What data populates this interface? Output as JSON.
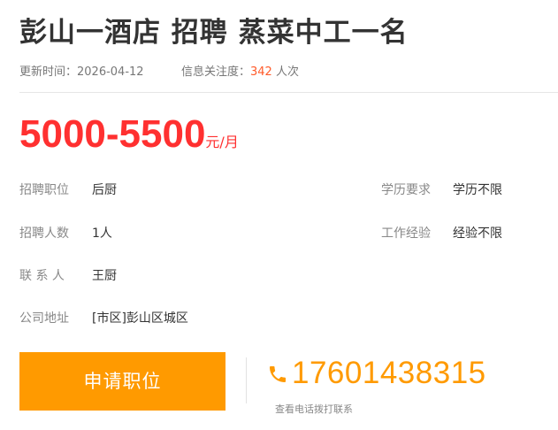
{
  "job": {
    "title": "彭山一酒店 招聘 蒸菜中工一名",
    "update_label": "更新时间：",
    "update_date": "2026-04-12",
    "attention_label": "信息关注度：",
    "attention_count": "342",
    "attention_unit": " 人次"
  },
  "salary": {
    "range": "5000-5500",
    "unit": "元/月"
  },
  "details": {
    "position": {
      "label": "招聘职位",
      "value": "后厨"
    },
    "education": {
      "label": "学历要求",
      "value": "学历不限"
    },
    "headcount": {
      "label": "招聘人数",
      "value": "1人"
    },
    "experience": {
      "label": "工作经验",
      "value": "经验不限"
    },
    "contact": {
      "label": "联 系 人",
      "value": "王厨"
    },
    "address": {
      "label": "公司地址",
      "value": "[市区]彭山区城区"
    }
  },
  "actions": {
    "apply_label": "申请职位",
    "phone_number": "17601438315",
    "phone_hint": "查看电话拨打联系",
    "phone_icon": "phone-icon"
  },
  "colors": {
    "salary": "#ff3030",
    "accent": "#ff9a00",
    "attention_count": "#ff5a29"
  }
}
